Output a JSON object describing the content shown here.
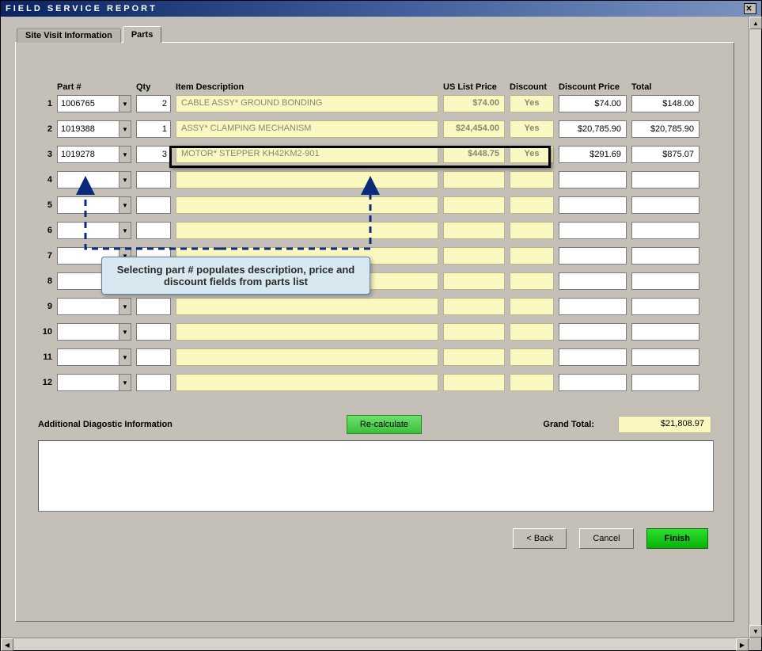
{
  "window": {
    "title": "FIELD SERVICE REPORT"
  },
  "tabs": {
    "inactive": "Site Visit Information",
    "active": "Parts"
  },
  "headers": {
    "part": "Part #",
    "qty": "Qty",
    "desc": "Item Description",
    "price": "US List Price",
    "disc": "Discount",
    "dprice": "Discount Price",
    "total": "Total"
  },
  "rows": [
    {
      "num": "1",
      "part": "1006765",
      "qty": "2",
      "desc": "CABLE ASSY* GROUND BONDING",
      "price": "$74.00",
      "disc": "Yes",
      "dprice": "$74.00",
      "total": "$148.00"
    },
    {
      "num": "2",
      "part": "1019388",
      "qty": "1",
      "desc": "ASSY* CLAMPING MECHANISM",
      "price": "$24,454.00",
      "disc": "Yes",
      "dprice": "$20,785.90",
      "total": "$20,785.90"
    },
    {
      "num": "3",
      "part": "1019278",
      "qty": "3",
      "desc": "MOTOR* STEPPER KH42KM2-901",
      "price": "$448.75",
      "disc": "Yes",
      "dprice": "$291.69",
      "total": "$875.07"
    },
    {
      "num": "4",
      "part": "",
      "qty": "",
      "desc": "",
      "price": "",
      "disc": "",
      "dprice": "",
      "total": ""
    },
    {
      "num": "5",
      "part": "",
      "qty": "",
      "desc": "",
      "price": "",
      "disc": "",
      "dprice": "",
      "total": ""
    },
    {
      "num": "6",
      "part": "",
      "qty": "",
      "desc": "",
      "price": "",
      "disc": "",
      "dprice": "",
      "total": ""
    },
    {
      "num": "7",
      "part": "",
      "qty": "",
      "desc": "",
      "price": "",
      "disc": "",
      "dprice": "",
      "total": ""
    },
    {
      "num": "8",
      "part": "",
      "qty": "",
      "desc": "",
      "price": "",
      "disc": "",
      "dprice": "",
      "total": ""
    },
    {
      "num": "9",
      "part": "",
      "qty": "",
      "desc": "",
      "price": "",
      "disc": "",
      "dprice": "",
      "total": ""
    },
    {
      "num": "10",
      "part": "",
      "qty": "",
      "desc": "",
      "price": "",
      "disc": "",
      "dprice": "",
      "total": ""
    },
    {
      "num": "11",
      "part": "",
      "qty": "",
      "desc": "",
      "price": "",
      "disc": "",
      "dprice": "",
      "total": ""
    },
    {
      "num": "12",
      "part": "",
      "qty": "",
      "desc": "",
      "price": "",
      "disc": "",
      "dprice": "",
      "total": ""
    }
  ],
  "callout": "Selecting part # populates description, price and discount fields from parts list",
  "footer": {
    "diag_label": "Additional Diagostic Information",
    "recalc": "Re-calculate",
    "grand_label": "Grand Total:",
    "grand_value": "$21,808.97"
  },
  "nav": {
    "back": "< Back",
    "cancel": "Cancel",
    "finish": "Finish"
  }
}
